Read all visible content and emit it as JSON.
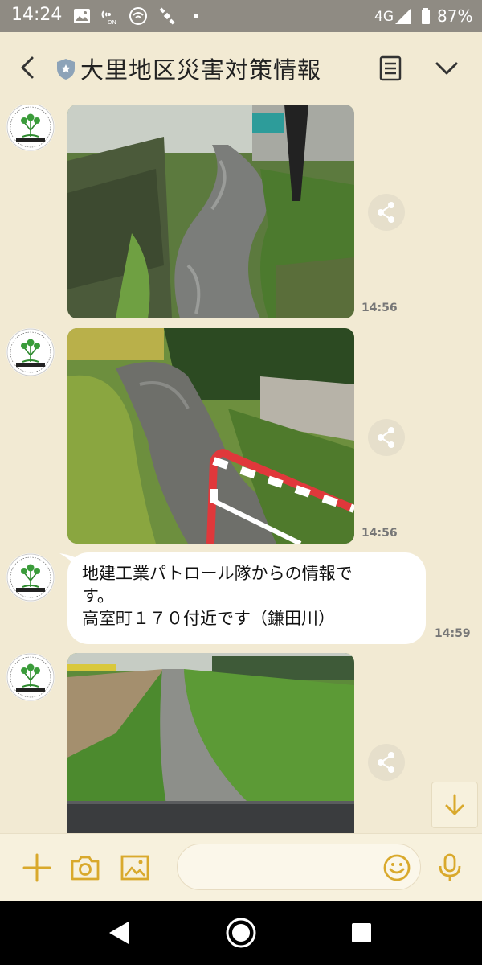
{
  "status_bar": {
    "time": "14:24",
    "network": "4G",
    "battery": "87%",
    "icons": [
      "gallery-icon",
      "volte-icon",
      "wifi-icon",
      "satellite-icon",
      "dot-icon",
      "signal-icon",
      "battery-icon"
    ]
  },
  "header": {
    "title": "大里地区災害対策情報",
    "icons": [
      "back-arrow-icon",
      "shield-badge-icon",
      "notes-icon",
      "chevron-down-icon"
    ]
  },
  "messages": [
    {
      "type": "image",
      "time": "14:56",
      "description_icon": "share-icon"
    },
    {
      "type": "image",
      "time": "14:56",
      "description_icon": "share-icon"
    },
    {
      "type": "text",
      "time": "14:59",
      "lines": [
        "地建工業パトロール隊からの情報で",
        "す。",
        "高室町１７０付近です（鎌田川）"
      ]
    },
    {
      "type": "image",
      "time": "",
      "description_icon": "share-icon"
    }
  ],
  "composer": {
    "placeholder": "",
    "icons": [
      "plus-icon",
      "camera-icon",
      "image-icon",
      "emoji-icon",
      "mic-icon"
    ]
  },
  "colors": {
    "background": "#f2ead3",
    "accent": "#d9a92c",
    "statusbar": "#8f8b83"
  }
}
